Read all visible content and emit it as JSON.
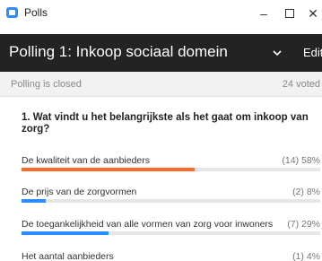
{
  "window": {
    "title": "Polls",
    "minimize_glyph": "–",
    "close_glyph": "✕"
  },
  "header": {
    "title": "Polling 1: Inkoop sociaal domein",
    "edit_label": "Edit"
  },
  "status": {
    "closed_text": "Polling is closed",
    "voted_text": "24 voted"
  },
  "question": {
    "text": "1. Wat vindt u het belangrijkste als het gaat om inkoop van zorg?"
  },
  "answers": [
    {
      "label": "De kwaliteit van de aanbieders",
      "count_pct": "(14) 58%",
      "percent": 58,
      "color": "#ff6d2d"
    },
    {
      "label": "De prijs van de zorgvormen",
      "count_pct": "(2) 8%",
      "percent": 8,
      "color": "#2d8cff"
    },
    {
      "label": "De toegankelijkheid van alle vormen van zorg voor inwoners",
      "count_pct": "(7) 29%",
      "percent": 29,
      "color": "#2d8cff"
    },
    {
      "label": "Het aantal aanbieders",
      "count_pct": "(1) 4%",
      "percent": 4,
      "color": "#2d8cff"
    }
  ]
}
